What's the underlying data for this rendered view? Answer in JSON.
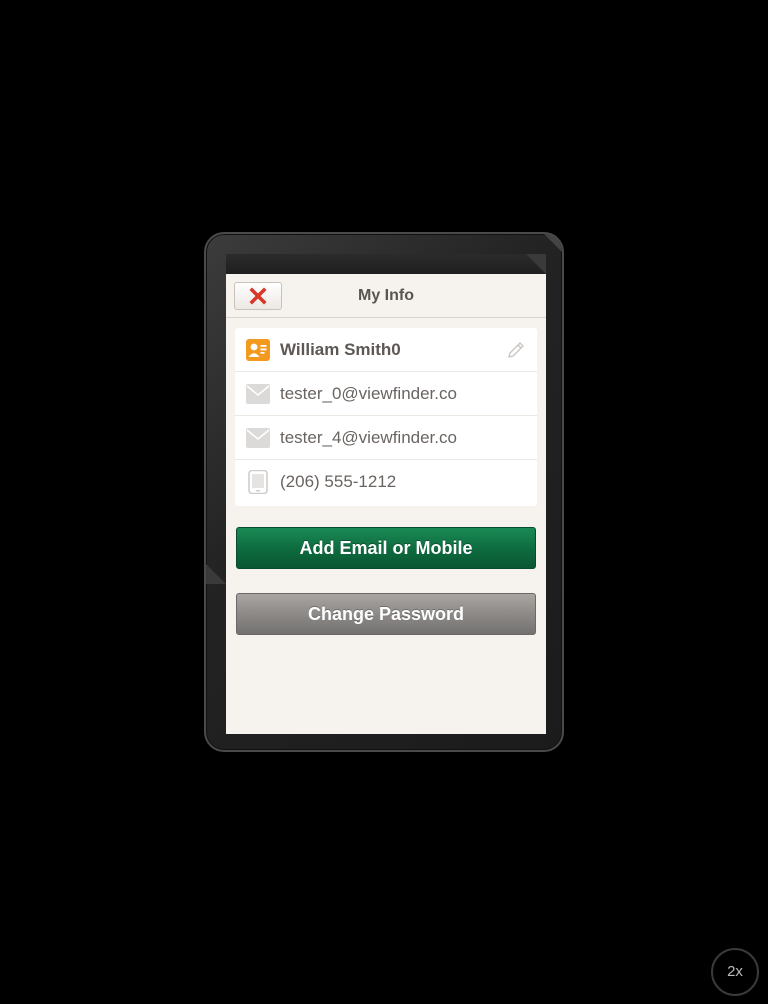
{
  "window": {
    "title": "My Info"
  },
  "navbar": {
    "close_icon": "close-x-icon",
    "title": "My Info"
  },
  "contact_card": {
    "rows": [
      {
        "icon": "contact-card-icon",
        "label": "William Smith0",
        "action_icon": "pencil-icon"
      },
      {
        "icon": "envelope-icon",
        "label": "tester_0@viewfinder.co"
      },
      {
        "icon": "envelope-icon",
        "label": "tester_4@viewfinder.co"
      },
      {
        "icon": "phone-icon",
        "label": "(206) 555-1212"
      }
    ]
  },
  "buttons": {
    "add_label": "Add Email or Mobile",
    "change_password_label": "Change Password"
  },
  "zoom": {
    "label": "2x"
  },
  "colors": {
    "accent_green": "#0d6a3e",
    "contact_orange": "#f39a1e",
    "close_red": "#d8372a",
    "gray_button": "#8a8785"
  }
}
